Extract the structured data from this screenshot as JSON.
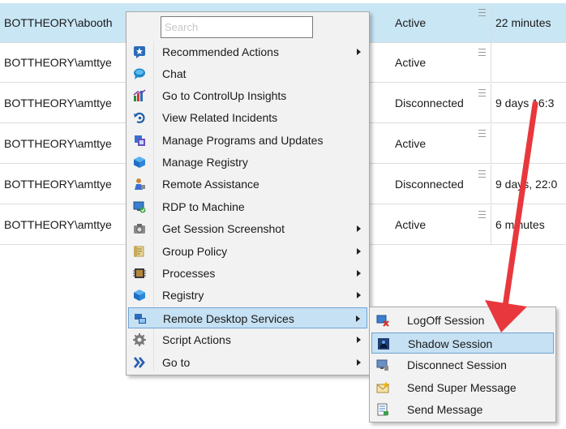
{
  "sessions": [
    {
      "user": "BOTTHEORY\\abooth",
      "status": "Active",
      "time": "22 minutes",
      "selected": true
    },
    {
      "user": "BOTTHEORY\\amttye",
      "status": "Active",
      "time": ""
    },
    {
      "user": "BOTTHEORY\\amttye",
      "status": "Disconnected",
      "time": "9 days 16:3"
    },
    {
      "user": "BOTTHEORY\\amttye",
      "status": "Active",
      "time": ""
    },
    {
      "user": "BOTTHEORY\\amttye",
      "status": "Disconnected",
      "time": "9 days, 22:0"
    },
    {
      "user": "BOTTHEORY\\amttye",
      "status": "Active",
      "time": "6 minutes"
    }
  ],
  "context_menu": {
    "search_placeholder": "Search",
    "items": [
      {
        "label": "Recommended Actions",
        "icon": "recommended-actions-icon",
        "submenu": true
      },
      {
        "label": "Chat",
        "icon": "chat-icon",
        "submenu": false
      },
      {
        "label": "Go to ControlUp Insights",
        "icon": "insights-icon",
        "submenu": false
      },
      {
        "label": "View Related Incidents",
        "icon": "incidents-icon",
        "submenu": false
      },
      {
        "label": "Manage Programs and Updates",
        "icon": "programs-icon",
        "submenu": false
      },
      {
        "label": "Manage Registry",
        "icon": "registry-icon",
        "submenu": false
      },
      {
        "label": "Remote Assistance",
        "icon": "remote-assistance-icon",
        "submenu": false
      },
      {
        "label": "RDP to Machine",
        "icon": "rdp-icon",
        "submenu": false
      },
      {
        "label": "Get Session Screenshot",
        "icon": "screenshot-icon",
        "submenu": true
      },
      {
        "label": "Group Policy",
        "icon": "group-policy-icon",
        "submenu": true
      },
      {
        "label": "Processes",
        "icon": "processes-icon",
        "submenu": true
      },
      {
        "label": "Registry",
        "icon": "registry-icon",
        "submenu": true
      },
      {
        "label": "Remote Desktop Services",
        "icon": "remote-desktop-icon",
        "submenu": true,
        "highlighted": true
      },
      {
        "label": "Script Actions",
        "icon": "script-gear-icon",
        "submenu": true
      },
      {
        "label": "Go to",
        "icon": "go-to-chevrons-icon",
        "submenu": true
      }
    ]
  },
  "submenu": {
    "items": [
      {
        "label": "LogOff Session",
        "icon": "logoff-icon"
      },
      {
        "label": "Shadow Session",
        "icon": "shadow-icon",
        "highlighted": true
      },
      {
        "label": "Disconnect Session",
        "icon": "disconnect-icon"
      },
      {
        "label": "Send Super Message",
        "icon": "super-message-icon"
      },
      {
        "label": "Send Message",
        "icon": "message-icon"
      }
    ]
  },
  "colors": {
    "selected_row": "#c9e6f5",
    "menu_highlight": "#c6e1f3",
    "annotation_arrow": "#e8383d"
  }
}
